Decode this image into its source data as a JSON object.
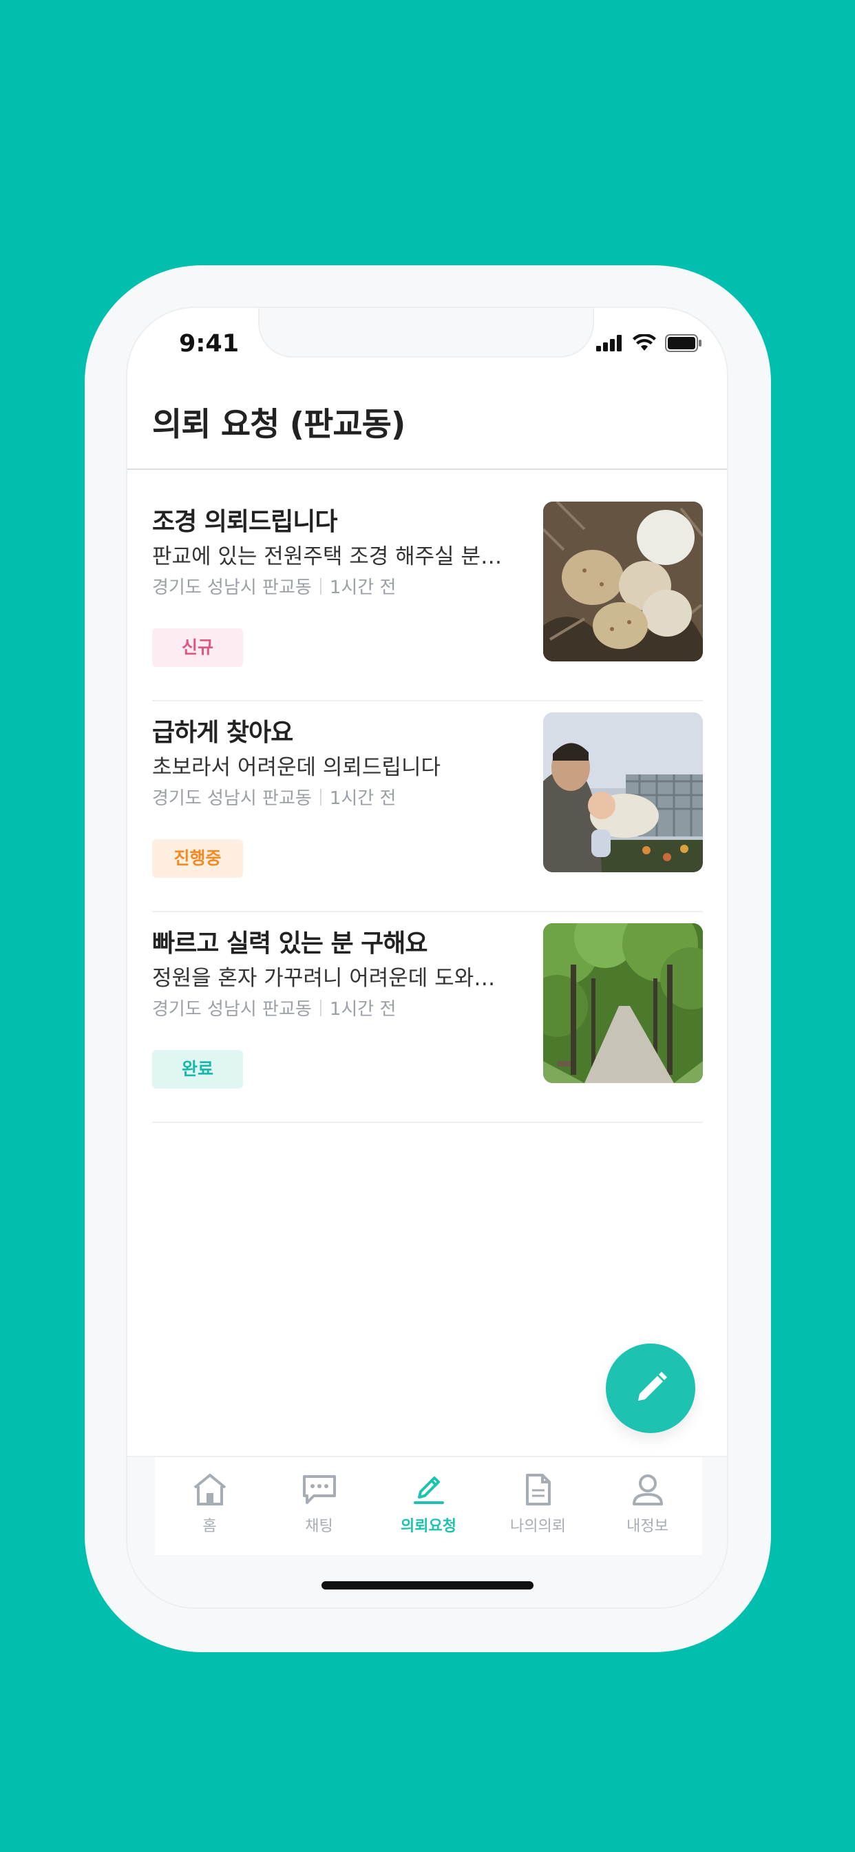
{
  "status_bar": {
    "time": "9:41"
  },
  "header": {
    "title": "의뢰 요청 (판교동)"
  },
  "requests": [
    {
      "title": "조경 의뢰드립니다",
      "description": "판교에 있는 전원주택 조경 해주실 분…",
      "location": "경기도 성남시 판교동",
      "time": "1시간 전",
      "status": "신규",
      "status_color": "#E2547D",
      "image": "eggs-in-nest"
    },
    {
      "title": "급하게 찾아요",
      "description": "초보라서 어려운데 의뢰드립니다",
      "location": "경기도 성남시 판교동",
      "time": "1시간 전",
      "status": "진행중",
      "status_color": "#F08A24",
      "image": "man-holding-baby"
    },
    {
      "title": "빠르고 실력 있는 분 구해요",
      "description": "정원을 혼자 가꾸려니 어려운데 도와…",
      "location": "경기도 성남시 판교동",
      "time": "1시간 전",
      "status": "완료",
      "status_color": "#18B9A8",
      "image": "tree-lined-path"
    }
  ],
  "fab": {
    "icon": "pencil-icon",
    "color": "#1EC2B0"
  },
  "tabs": [
    {
      "label": "홈",
      "icon": "home-icon",
      "active": false
    },
    {
      "label": "채팅",
      "icon": "chat-icon",
      "active": false
    },
    {
      "label": "의뢰요청",
      "icon": "pencil-icon",
      "active": true
    },
    {
      "label": "나의의뢰",
      "icon": "document-icon",
      "active": false
    },
    {
      "label": "내정보",
      "icon": "person-icon",
      "active": false
    }
  ],
  "colors": {
    "background": "#00BFAE",
    "accent": "#1EC2B0"
  }
}
